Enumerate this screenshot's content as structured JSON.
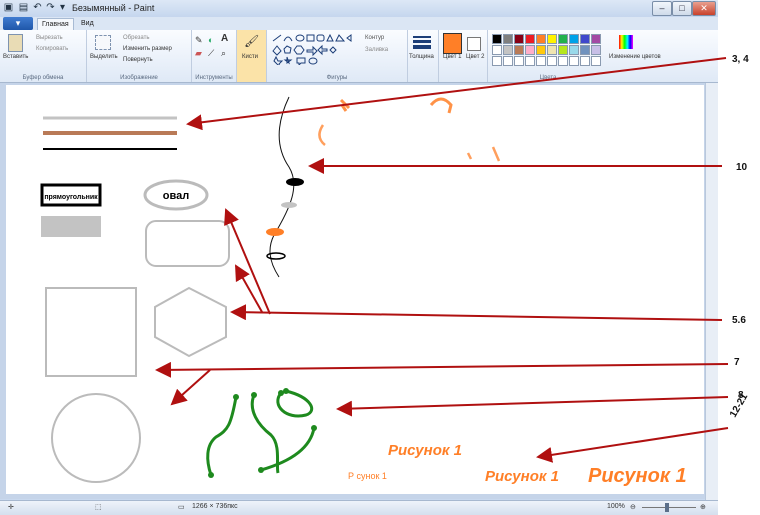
{
  "window": {
    "title": "Безымянный - Paint",
    "buttons": [
      "–",
      "□",
      "✕"
    ]
  },
  "tabs": [
    "Главная",
    "Вид"
  ],
  "ribbon": {
    "clipboard": {
      "label": "Буфер обмена",
      "paste": "Вставить",
      "cut": "Вырезать",
      "copy": "Копировать"
    },
    "image": {
      "label": "Изображение",
      "select": "Выделить",
      "crop": "Обрезать",
      "resize": "Изменить размер",
      "rotate": "Повернуть"
    },
    "tools": {
      "label": "Инструменты"
    },
    "brushes": {
      "label": "Кисти"
    },
    "shapes": {
      "label": "Фигуры",
      "outline": "Контур",
      "fill": "Заливка"
    },
    "size": {
      "label": "Толщина"
    },
    "color1": "Цвет 1",
    "color2": "Цвет 2",
    "colors": {
      "label": "Цвета",
      "edit": "Изменение цветов"
    },
    "palette": [
      "#000000",
      "#7f7f7f",
      "#880015",
      "#ed1c24",
      "#ff7f27",
      "#fff200",
      "#22b14c",
      "#00a2e8",
      "#3f48cc",
      "#a349a4",
      "#ffffff",
      "#c3c3c3",
      "#b97a57",
      "#ffaec9",
      "#ffc90e",
      "#efe4b0",
      "#b5e61d",
      "#99d9ea",
      "#7092be",
      "#c8bfe7"
    ]
  },
  "drawing": {
    "rect_label": "прямоугольник",
    "oval_label": "овал",
    "text1": "Рисунок 1",
    "text2": "Рисунок 1",
    "text3": "Рисунок 1",
    "text_small": "Р сунок 1"
  },
  "callouts": {
    "c1": "3, 4",
    "c2": "10",
    "c3": "5.6",
    "c4": "7",
    "c5": "8",
    "c6": "12-21"
  },
  "status": {
    "dimensions": "1266 × 736пкс",
    "zoom": "100%"
  },
  "colors": {
    "orange": "#ff7f27",
    "green": "#1e8a1e",
    "arrow": "#b01010",
    "accent": "#1f57a9"
  }
}
